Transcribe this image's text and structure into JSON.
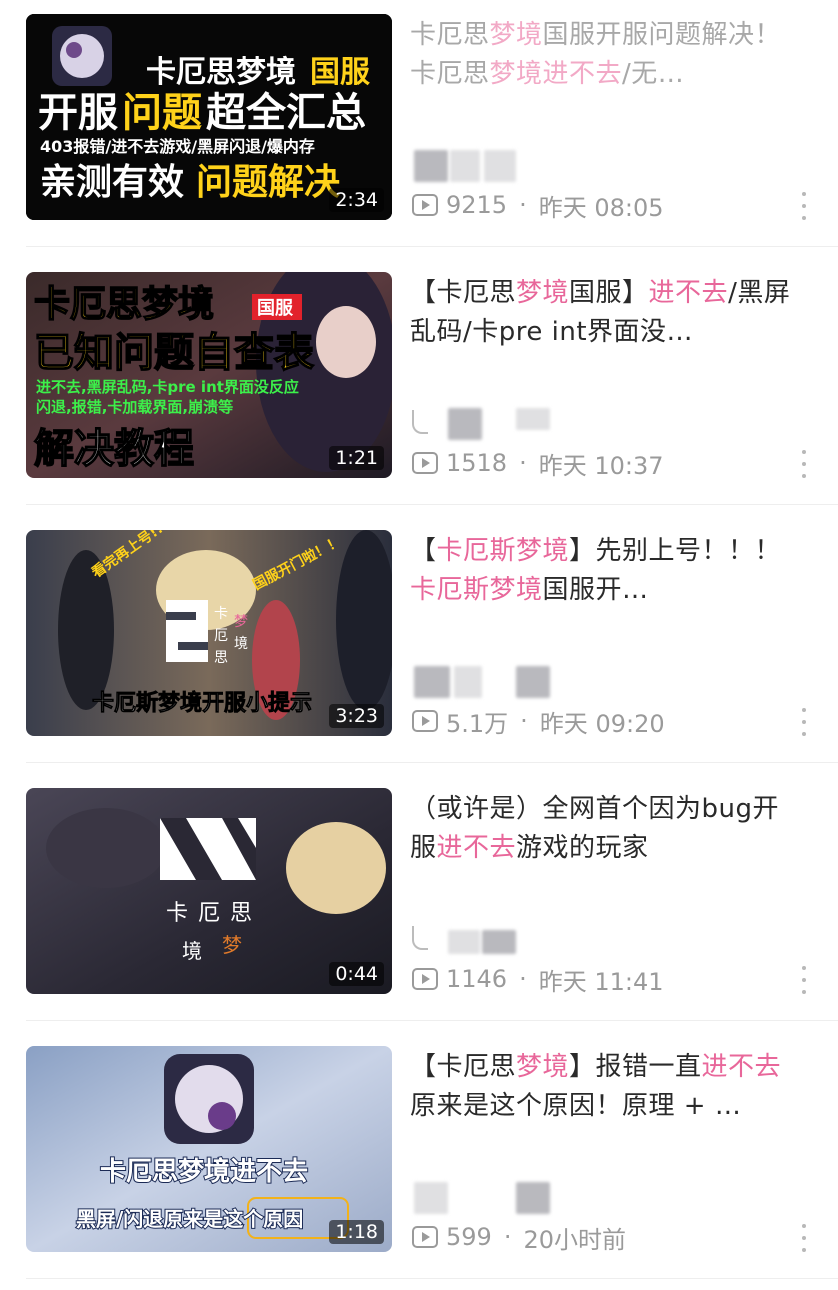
{
  "videos": [
    {
      "title_segments": [
        {
          "text": "卡厄思",
          "hl": false
        },
        {
          "text": "梦境",
          "hl": true
        },
        {
          "text": "国服开服问题解决！卡厄思",
          "hl": false
        },
        {
          "text": "梦境",
          "hl": true
        },
        {
          "text": "进不去",
          "hl": true
        },
        {
          "text": "/无…",
          "hl": false
        }
      ],
      "faded": true,
      "views": "9215",
      "time": "昨天 08:05",
      "duration": "2:34",
      "thumb_text": {
        "line1a": "卡厄思梦境",
        "line1b": "国服",
        "line2a": "开服",
        "line2b": "问题",
        "line2c": "超全汇总",
        "line3": "403报错/进不去游戏/黑屏闪退/爆内存",
        "line4a": "亲测有效",
        "line4b": "问题解决"
      }
    },
    {
      "title_segments": [
        {
          "text": "【卡厄思",
          "hl": false
        },
        {
          "text": "梦境",
          "hl": true
        },
        {
          "text": "国服】",
          "hl": false
        },
        {
          "text": "进不去",
          "hl": true
        },
        {
          "text": "/黑屏乱码/卡pre int界面没…",
          "hl": false
        }
      ],
      "faded": false,
      "views": "1518",
      "time": "昨天 10:37",
      "duration": "1:21",
      "thumb_text": {
        "line1": "卡厄思梦境",
        "badge": "国服",
        "line2": "已知问题自查表",
        "line3": "进不去,黑屏乱码,卡pre int界面没反应",
        "line4": "闪退,报错,卡加载界面,崩溃等",
        "line5": "解决教程"
      }
    },
    {
      "title_segments": [
        {
          "text": "【",
          "hl": false
        },
        {
          "text": "卡厄斯梦境",
          "hl": true
        },
        {
          "text": "】先别上号！！！",
          "hl": false
        },
        {
          "text": "卡厄斯梦境",
          "hl": true
        },
        {
          "text": "国服开…",
          "hl": false
        }
      ],
      "faded": false,
      "views": "5.1万",
      "time": "昨天 09:20",
      "duration": "3:23",
      "thumb_text": {
        "tag1": "看完再上号!!",
        "tag2": "国服开门啦！！",
        "logo1": "卡",
        "logo2": "厄",
        "logo3": "思",
        "logo4": "梦",
        "logo5": "境",
        "caption": "卡厄斯梦境开服小提示"
      }
    },
    {
      "title_segments": [
        {
          "text": "（或许是）全网首个因为bug开服",
          "hl": false
        },
        {
          "text": "进不去",
          "hl": true
        },
        {
          "text": "游戏的玩家",
          "hl": false
        }
      ],
      "faded": false,
      "views": "1146",
      "time": "昨天 11:41",
      "duration": "0:44",
      "thumb_text": {
        "logo1": "卡",
        "logo2": "厄",
        "logo3": "思",
        "logo4": "境",
        "logo5": "梦"
      }
    },
    {
      "title_segments": [
        {
          "text": "【卡厄思",
          "hl": false
        },
        {
          "text": "梦境",
          "hl": true
        },
        {
          "text": "】报错一直",
          "hl": false
        },
        {
          "text": "进不去",
          "hl": true
        },
        {
          "text": "原来是这个原因！原理 + …",
          "hl": false
        }
      ],
      "faded": false,
      "views": "599",
      "time": "20小时前",
      "duration": "1:18",
      "thumb_text": {
        "line1": "卡厄思梦境进不去",
        "line2": "黑屏/闪退原来是这个原因"
      }
    }
  ],
  "colors": {
    "highlight": "#e8679a",
    "meta": "#9a9a9a",
    "text": "#2a2a2a"
  },
  "icons": {
    "views": "play-count-icon",
    "uploader": "uploader-icon",
    "more": "more-vertical-icon"
  }
}
